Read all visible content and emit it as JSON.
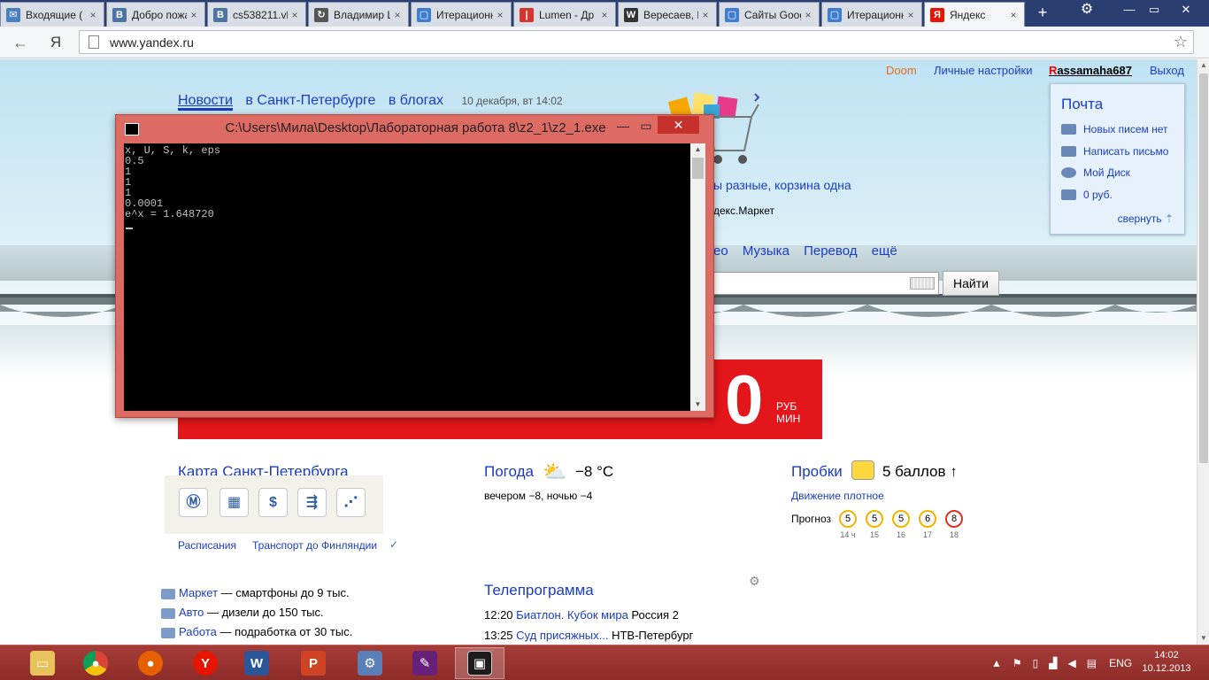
{
  "browser": {
    "tabs": [
      {
        "title": "Входящие (",
        "icon": "mail-icon",
        "color": "#4a7fc1",
        "glyph": "✉"
      },
      {
        "title": "Добро пожа",
        "icon": "vk-icon",
        "color": "#4c75a3",
        "glyph": "B"
      },
      {
        "title": "cs538211.vk",
        "icon": "vk-icon",
        "color": "#4c75a3",
        "glyph": "B"
      },
      {
        "title": "Владимир L",
        "icon": "loading-icon",
        "color": "#555555",
        "glyph": "↻"
      },
      {
        "title": "Итерационн",
        "icon": "document-icon",
        "color": "#3f7dd1",
        "glyph": "▢"
      },
      {
        "title": "Lumen - Др",
        "icon": "lumen-icon",
        "color": "#d4352c",
        "glyph": "|"
      },
      {
        "title": "Вересаев, В",
        "icon": "wikipedia-icon",
        "color": "#333333",
        "glyph": "W"
      },
      {
        "title": "Сайты Goog",
        "icon": "google-sites-icon",
        "color": "#3f7dd1",
        "glyph": "▢"
      },
      {
        "title": "Итерационн",
        "icon": "document-icon",
        "color": "#3f7dd1",
        "glyph": "▢"
      },
      {
        "title": "Яндекс",
        "icon": "yandex-icon",
        "color": "#e61400",
        "glyph": "Я"
      }
    ],
    "new_tab": "+",
    "url": "www.yandex.ru",
    "yandex_button": "Я"
  },
  "page": {
    "toplinks": {
      "doom": "Doom",
      "settings": "Личные настройки",
      "user_first": "R",
      "user_rest": "assamaha687",
      "logout": "Выход"
    },
    "mail": {
      "title": "Почта",
      "no_new": "Новых писем нет",
      "compose": "Написать письмо",
      "disk": "Мой Диск",
      "balance": "0 руб.",
      "collapse": "свернуть"
    },
    "news": {
      "tab1": "Новости",
      "tab2": "в Санкт-Петербурге",
      "tab3": "в блогах",
      "date": "10 декабря, вт 14:02"
    },
    "market_promo": "ы разные, корзина одна",
    "market_sub": "декс.Маркет",
    "services": [
      "ео",
      "Музыка",
      "Перевод",
      "ещё"
    ],
    "search_button": "Найти",
    "banner": {
      "zero": "0",
      "rub": "РУБ",
      "min": "МИН"
    },
    "map": {
      "title": "Карта Санкт-Петербурга",
      "link1": "Расписания",
      "link2": "Транспорт до Финляндии"
    },
    "weather": {
      "title": "Погода",
      "temp": "−8 °С",
      "detail": "вечером −8,  ночью −4"
    },
    "traffic": {
      "title": "Пробки",
      "score": "5 баллов ↑",
      "status": "Движение плотное",
      "forecast_label": "Прогноз",
      "forecast": [
        {
          "val": "5",
          "time": "14 ч",
          "color": "#f0b400"
        },
        {
          "val": "5",
          "time": "15",
          "color": "#f0b400"
        },
        {
          "val": "5",
          "time": "16",
          "color": "#f0b400"
        },
        {
          "val": "6",
          "time": "17",
          "color": "#f0b400"
        },
        {
          "val": "8",
          "time": "18",
          "color": "#e0301e"
        }
      ]
    },
    "list": [
      {
        "link": "Маркет",
        "text": " — смартфоны до 9 тыс."
      },
      {
        "link": "Авто",
        "text": " — дизели до 150 тыс."
      },
      {
        "link": "Работа",
        "text": " — подработка от 30 тыс."
      }
    ],
    "tv": {
      "title": "Телепрограмма",
      "items": [
        {
          "time": "12:20",
          "show": "Биатлон. Кубок мира",
          "channel": " Россия 2"
        },
        {
          "time": "13:25",
          "show": "Суд присяжных...",
          "channel": " НТВ-Петербург"
        }
      ]
    }
  },
  "console": {
    "title": "C:\\Users\\Мила\\Desktop\\Лабораторная работа 8\\z2_1\\z2_1.exe",
    "output": "x, U, S, k, eps\n0.5\n1\n1\n1\n0.0001\ne^x = 1.648720\n"
  },
  "taskbar": {
    "lang": "ENG",
    "time": "14:02",
    "date": "10.12.2013"
  }
}
